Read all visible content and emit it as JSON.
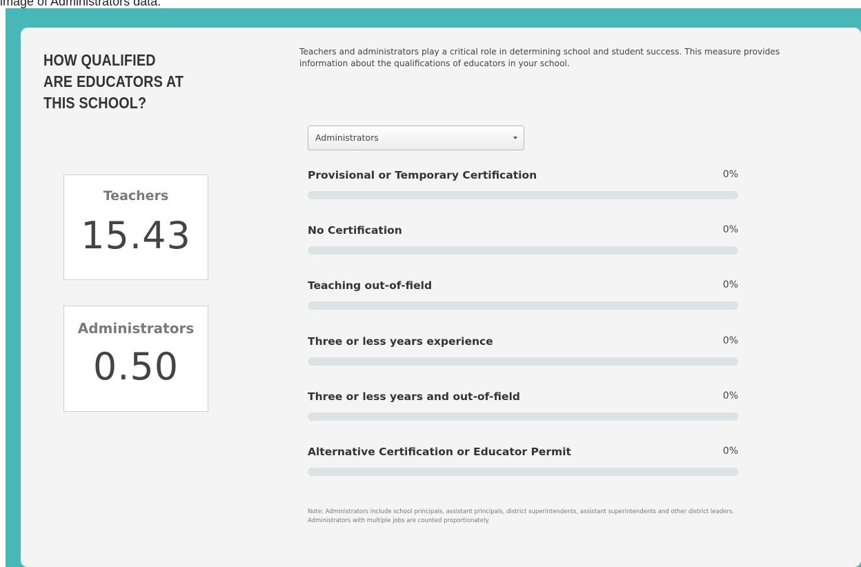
{
  "caption": "image of Administrators data.",
  "heading": "HOW QUALIFIED ARE EDUCATORS AT THIS SCHOOL?",
  "intro": "Teachers and administrators play a critical role in determining school and student success. This measure provides information about the qualifications of educators in your school.",
  "stats": [
    {
      "label": "Teachers",
      "value": "15.43"
    },
    {
      "label": "Administrators",
      "value": "0.50"
    }
  ],
  "dropdown": {
    "selected": "Administrators"
  },
  "metrics": [
    {
      "label": "Provisional or Temporary Certification",
      "value": "0%",
      "fraction": 0
    },
    {
      "label": "No Certification",
      "value": "0%",
      "fraction": 0
    },
    {
      "label": "Teaching out-of-field",
      "value": "0%",
      "fraction": 0
    },
    {
      "label": "Three or less years experience",
      "value": "0%",
      "fraction": 0
    },
    {
      "label": "Three or less years and out-of-field",
      "value": "0%",
      "fraction": 0
    },
    {
      "label": "Alternative Certification or Educator Permit",
      "value": "0%",
      "fraction": 0
    }
  ],
  "note": "Note: Administrators include school principals, assistant principals, district superintendents, assistant superintendents and other district leaders. Administrators with multiple jobs are counted proportionately.",
  "colors": {
    "frame": "#47b7b7",
    "card": "#f4f4f4",
    "bar_track": "#dde3e4"
  }
}
